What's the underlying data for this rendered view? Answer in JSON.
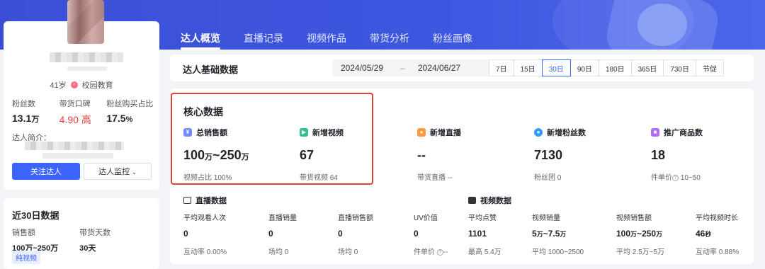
{
  "nav": {
    "tabs": [
      {
        "label": "达人概览",
        "active": true
      },
      {
        "label": "直播记录",
        "active": false
      },
      {
        "label": "视频作品",
        "active": false
      },
      {
        "label": "带货分析",
        "active": false
      },
      {
        "label": "粉丝画像",
        "active": false
      }
    ]
  },
  "profile": {
    "age": "41岁",
    "category": "校园教育",
    "stats": [
      {
        "label": "粉丝数",
        "value": "13.1",
        "unit": "万"
      },
      {
        "label": "带货口碑",
        "value": "4.90",
        "unit": "高"
      },
      {
        "label": "粉丝购买占比",
        "value": "17.5",
        "unit": "%"
      }
    ],
    "intro_label": "达人简介：",
    "follow_button": "关注达人",
    "monitor_button": "达人监控"
  },
  "recent": {
    "title": "近30日数据",
    "cols": [
      {
        "label": "销售额",
        "value": "100万~250万"
      },
      {
        "label": "带货天数",
        "value": "30天"
      }
    ],
    "tag": "纯视频"
  },
  "datebar": {
    "title": "达人基础数据",
    "start": "2024/05/29",
    "separator": "–",
    "end": "2024/06/27",
    "periods": [
      "7日",
      "15日",
      "30日",
      "90日",
      "180日",
      "365日",
      "730日",
      "节促"
    ],
    "active_period": "30日"
  },
  "core": {
    "title": "核心数据",
    "items": [
      {
        "label": "总销售额",
        "value_a": "100",
        "unit_a": "万",
        "value_sep": "~",
        "value_b": "250",
        "unit_b": "万",
        "sub": "视频占比 100%",
        "icon": "yen-icon",
        "color": "#6e8cff"
      },
      {
        "label": "新增视频",
        "value_a": "67",
        "sub": "带货视频 64",
        "icon": "video-icon",
        "color": "#2fc28b"
      },
      {
        "label": "新增直播",
        "value_a": "--",
        "sub": "带货直播 --",
        "icon": "live-icon",
        "color": "#ff9a3c"
      },
      {
        "label": "新增粉丝数",
        "value_a": "7130",
        "sub": "粉丝团 0",
        "icon": "fans-icon",
        "color": "#2f9bff"
      },
      {
        "label": "推广商品数",
        "value_a": "18",
        "sub_label": "件单价",
        "sub_value": "10~50",
        "icon": "goods-icon",
        "color": "#b26bff"
      }
    ]
  },
  "live": {
    "title": "直播数据",
    "items": [
      {
        "label": "平均观看人次",
        "value": "0",
        "sub": "互动率 0.00%"
      },
      {
        "label": "直播销量",
        "value": "0",
        "sub": "场均 0"
      },
      {
        "label": "直播销售额",
        "value": "0",
        "sub": "场均 0"
      },
      {
        "label": "UV价值",
        "value": "0",
        "sub_label": "件单价",
        "sub_value": "--"
      }
    ]
  },
  "video": {
    "title": "视频数据",
    "items": [
      {
        "label": "平均点赞",
        "value": "1101",
        "sub": "最高 5.4万"
      },
      {
        "label": "视频销量",
        "value_a": "5",
        "unit_a": "万",
        "value_sep": "~",
        "value_b": "7.5",
        "unit_b": "万",
        "sub": "平均 1000~2500"
      },
      {
        "label": "视频销售额",
        "value_a": "100",
        "unit_a": "万",
        "value_sep": "~",
        "value_b": "250",
        "unit_b": "万",
        "sub": "平均 2.5万~5万"
      },
      {
        "label": "平均视频时长",
        "value_a": "46",
        "unit_a": "秒",
        "sub": "互动率 0.88%"
      }
    ]
  }
}
